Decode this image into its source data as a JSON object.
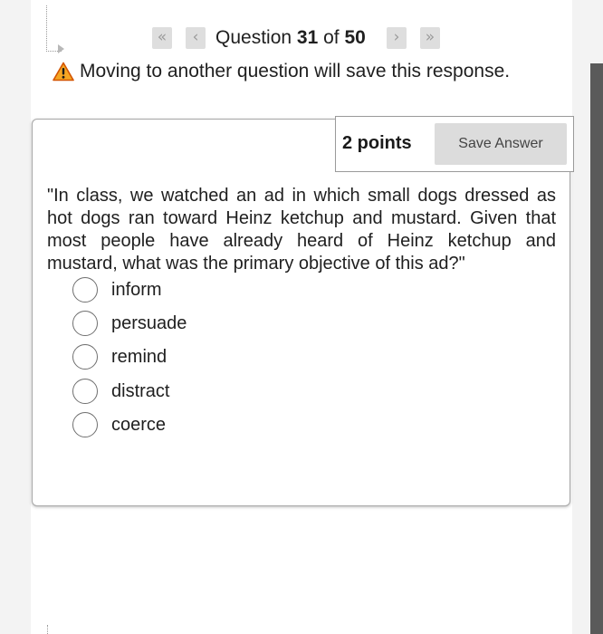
{
  "navigation": {
    "first_icon": "double-chevron-left",
    "prev_icon": "chevron-left",
    "next_icon": "chevron-right",
    "last_icon": "double-chevron-right",
    "label_prefix": "Question",
    "current": "31",
    "label_of": "of",
    "total": "50"
  },
  "warning": {
    "icon": "warning-triangle",
    "text": "Moving to another question will save this response."
  },
  "question": {
    "points": "2 points",
    "save_label": "Save Answer",
    "text": "\"In class, we watched an ad in which small dogs dressed as hot dogs ran toward Heinz ketchup and mustard. Given that most people have already heard of Heinz ketchup and mustard, what was the primary objective of this ad?\"",
    "options": [
      {
        "label": "inform",
        "selected": false
      },
      {
        "label": "persuade",
        "selected": false
      },
      {
        "label": "remind",
        "selected": false
      },
      {
        "label": "distract",
        "selected": false
      },
      {
        "label": "coerce",
        "selected": false
      }
    ]
  },
  "colors": {
    "warning_fill": "#f5a623",
    "warning_border": "#d35400",
    "nav_button": "#dedede",
    "save_button": "#dcdcdc"
  }
}
